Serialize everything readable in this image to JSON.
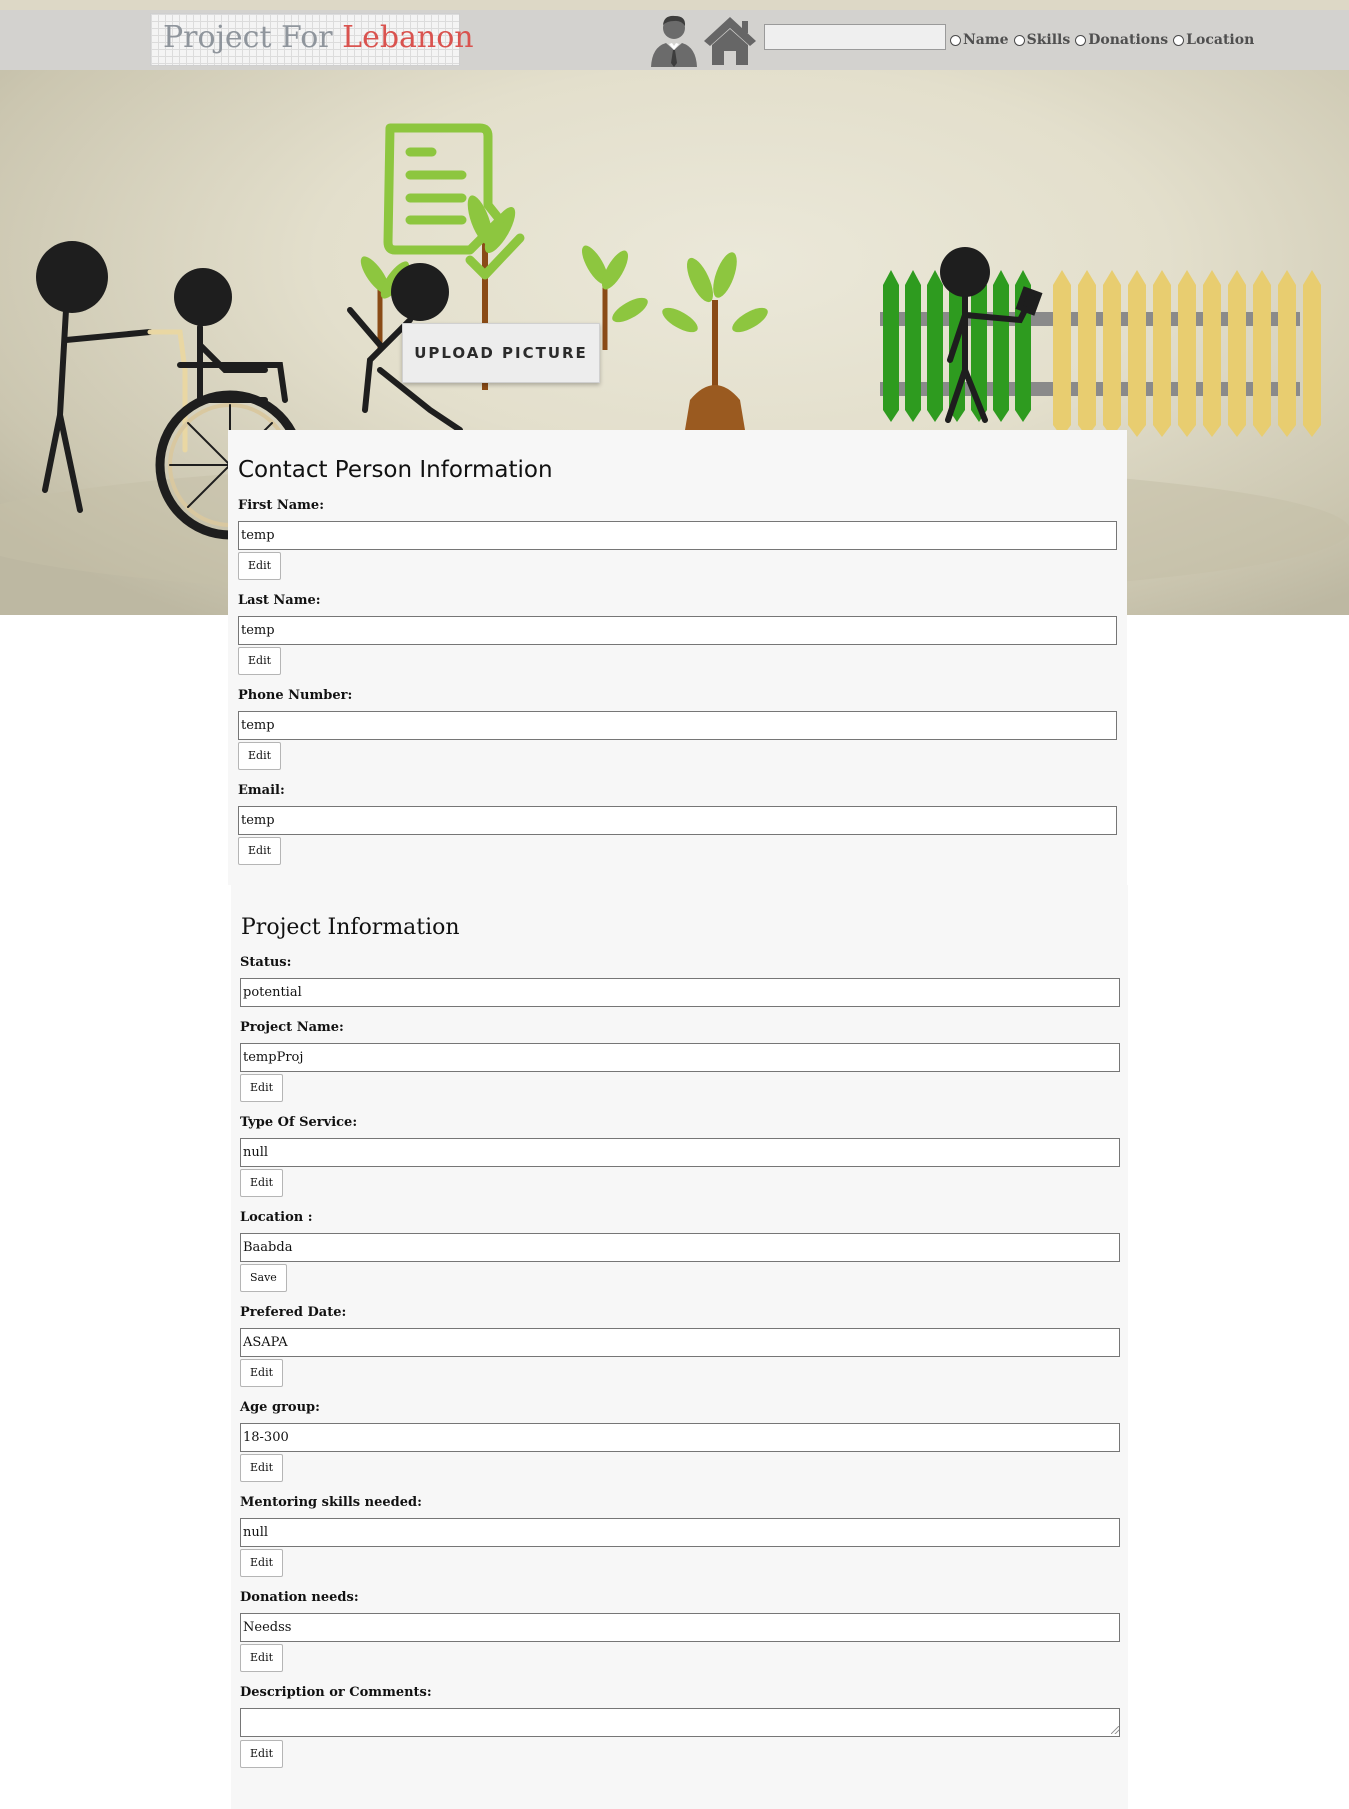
{
  "header": {
    "logo_part1": "Project For ",
    "logo_part2": "Lebanon",
    "search": {
      "value": ""
    },
    "filters": [
      "Name",
      "Skills",
      "Donations",
      "Location"
    ],
    "icons": [
      "profile-icon",
      "home-icon"
    ]
  },
  "hero": {
    "upload_label": "UPLOAD PICTURE"
  },
  "contact": {
    "title": "Contact Person Information",
    "fields": [
      {
        "label": "First Name:",
        "value": "temp",
        "button": "Edit"
      },
      {
        "label": "Last Name:",
        "value": "temp",
        "button": "Edit"
      },
      {
        "label": "Phone Number:",
        "value": "temp",
        "button": "Edit"
      },
      {
        "label": "Email:",
        "value": "temp",
        "button": "Edit"
      }
    ]
  },
  "project": {
    "title": "Project Information",
    "status": {
      "label": "Status:",
      "value": "potential"
    },
    "fields": [
      {
        "label": "Project Name:",
        "value": "tempProj",
        "button": "Edit"
      },
      {
        "label": "Type Of Service:",
        "value": "null",
        "button": "Edit"
      },
      {
        "label": "Location :",
        "value": "Baabda",
        "button": "Save"
      },
      {
        "label": "Prefered Date:",
        "value": "ASAPA",
        "button": "Edit"
      },
      {
        "label": "Age group:",
        "value": "18-300",
        "button": "Edit"
      },
      {
        "label": "Mentoring skills needed:",
        "value": "null",
        "button": "Edit"
      },
      {
        "label": "Donation needs:",
        "value": "Needss",
        "button": "Edit"
      },
      {
        "label": "Description or Comments:",
        "value": "",
        "button": "Edit"
      }
    ]
  },
  "colors": {
    "header_bg": "#d3d2cf",
    "logo_grey": "#8f959c",
    "logo_red": "#d9534f",
    "doc_green": "#8dc63f",
    "fence_green": "#2e9b1f",
    "fence_yellow": "#e8cd70",
    "panel_bg": "#f7f7f7"
  }
}
